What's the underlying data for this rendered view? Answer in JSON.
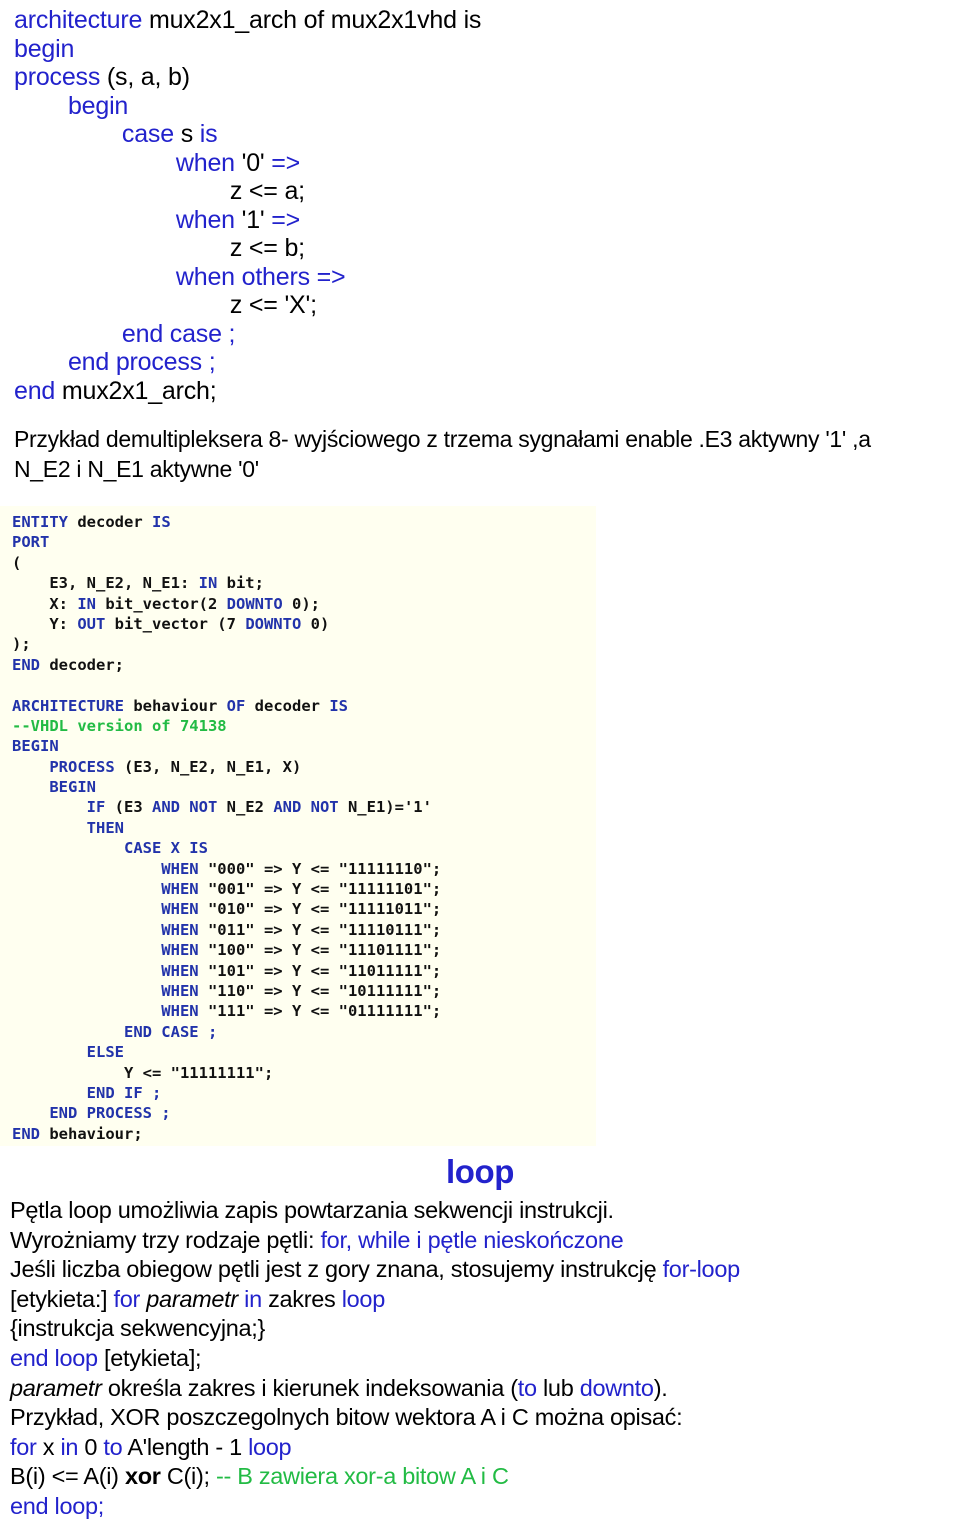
{
  "colors": {
    "keyword_blue": "#2222cc",
    "code_keyword_blue": "#2233aa",
    "comment_green": "#22bb44",
    "text_black": "#000000",
    "code_background": "#fffff0",
    "page_background": "#ffffff"
  },
  "vhdl_mux_listing": {
    "lines": [
      [
        {
          "t": "architecture ",
          "c": "kw"
        },
        {
          "t": "mux2x1_arch of mux2x1vhd is",
          "c": "id"
        }
      ],
      [
        {
          "t": "begin",
          "c": "kw"
        }
      ],
      [
        {
          "t": "process ",
          "c": "kw"
        },
        {
          "t": "(s, a, b)",
          "c": "id"
        }
      ],
      [
        {
          "t": "        begin",
          "c": "kw"
        }
      ],
      [
        {
          "t": "                case ",
          "c": "kw"
        },
        {
          "t": "s ",
          "c": "id"
        },
        {
          "t": "is",
          "c": "kw"
        }
      ],
      [
        {
          "t": "                        when ",
          "c": "kw"
        },
        {
          "t": "'0' ",
          "c": "id"
        },
        {
          "t": "=>",
          "c": "kw"
        }
      ],
      [
        {
          "t": "                                z <= a;",
          "c": "id"
        }
      ],
      [
        {
          "t": "                        when ",
          "c": "kw"
        },
        {
          "t": "'1' ",
          "c": "id"
        },
        {
          "t": "=>",
          "c": "kw"
        }
      ],
      [
        {
          "t": "                                z <= b;",
          "c": "id"
        }
      ],
      [
        {
          "t": "                        when others =>",
          "c": "kw"
        }
      ],
      [
        {
          "t": "                                z <= 'X';",
          "c": "id"
        }
      ],
      [
        {
          "t": "                end case ;",
          "c": "kw"
        }
      ],
      [
        {
          "t": "        end process ;",
          "c": "kw"
        }
      ],
      [
        {
          "t": "end ",
          "c": "kw"
        },
        {
          "t": "mux2x1_arch;",
          "c": "id"
        }
      ]
    ]
  },
  "demux_paragraph": {
    "lines": [
      "Przykład demultipleksera 8- wyjściowego z trzema sygnałami enable .E3 aktywny '1' ,a",
      "N_E2 i N_E1 aktywne '0'"
    ]
  },
  "decoder_code": {
    "lines": [
      [
        {
          "t": "ENTITY ",
          "c": "kw"
        },
        {
          "t": "decoder ",
          "c": "id"
        },
        {
          "t": "IS",
          "c": "kw"
        }
      ],
      [
        {
          "t": "PORT",
          "c": "kw"
        }
      ],
      [
        {
          "t": "(",
          "c": "id"
        }
      ],
      [
        {
          "t": "    E3, N_E2, N_E1: ",
          "c": "id"
        },
        {
          "t": "IN ",
          "c": "kw"
        },
        {
          "t": "bit;",
          "c": "id"
        }
      ],
      [
        {
          "t": "    X: ",
          "c": "id"
        },
        {
          "t": "IN ",
          "c": "kw"
        },
        {
          "t": "bit_vector(2 ",
          "c": "id"
        },
        {
          "t": "DOWNTO ",
          "c": "kw"
        },
        {
          "t": "0);",
          "c": "id"
        }
      ],
      [
        {
          "t": "    Y: ",
          "c": "id"
        },
        {
          "t": "OUT ",
          "c": "kw"
        },
        {
          "t": "bit_vector (7 ",
          "c": "id"
        },
        {
          "t": "DOWNTO ",
          "c": "kw"
        },
        {
          "t": "0)",
          "c": "id"
        }
      ],
      [
        {
          "t": ");",
          "c": "id"
        }
      ],
      [
        {
          "t": "END ",
          "c": "kw"
        },
        {
          "t": "decoder;",
          "c": "id"
        }
      ],
      [
        {
          "t": "",
          "c": "id"
        }
      ],
      [
        {
          "t": "ARCHITECTURE ",
          "c": "kw"
        },
        {
          "t": "behaviour ",
          "c": "id"
        },
        {
          "t": "OF ",
          "c": "kw"
        },
        {
          "t": "decoder ",
          "c": "id"
        },
        {
          "t": "IS",
          "c": "kw"
        }
      ],
      [
        {
          "t": "--VHDL version of 74138",
          "c": "cm"
        }
      ],
      [
        {
          "t": "BEGIN",
          "c": "kw"
        }
      ],
      [
        {
          "t": "    PROCESS ",
          "c": "kw"
        },
        {
          "t": "(E3, N_E2, N_E1, X)",
          "c": "id"
        }
      ],
      [
        {
          "t": "    BEGIN",
          "c": "kw"
        }
      ],
      [
        {
          "t": "        IF ",
          "c": "kw"
        },
        {
          "t": "(E3 ",
          "c": "id"
        },
        {
          "t": "AND NOT ",
          "c": "kw"
        },
        {
          "t": "N_E2 ",
          "c": "id"
        },
        {
          "t": "AND NOT ",
          "c": "kw"
        },
        {
          "t": "N_E1)='1'",
          "c": "id"
        }
      ],
      [
        {
          "t": "        THEN",
          "c": "kw"
        }
      ],
      [
        {
          "t": "            CASE X IS",
          "c": "kw"
        }
      ],
      [
        {
          "t": "                WHEN ",
          "c": "kw"
        },
        {
          "t": "\"000\" => Y <= \"11111110\";",
          "c": "id"
        }
      ],
      [
        {
          "t": "                WHEN ",
          "c": "kw"
        },
        {
          "t": "\"001\" => Y <= \"11111101\";",
          "c": "id"
        }
      ],
      [
        {
          "t": "                WHEN ",
          "c": "kw"
        },
        {
          "t": "\"010\" => Y <= \"11111011\";",
          "c": "id"
        }
      ],
      [
        {
          "t": "                WHEN ",
          "c": "kw"
        },
        {
          "t": "\"011\" => Y <= \"11110111\";",
          "c": "id"
        }
      ],
      [
        {
          "t": "                WHEN ",
          "c": "kw"
        },
        {
          "t": "\"100\" => Y <= \"11101111\";",
          "c": "id"
        }
      ],
      [
        {
          "t": "                WHEN ",
          "c": "kw"
        },
        {
          "t": "\"101\" => Y <= \"11011111\";",
          "c": "id"
        }
      ],
      [
        {
          "t": "                WHEN ",
          "c": "kw"
        },
        {
          "t": "\"110\" => Y <= \"10111111\";",
          "c": "id"
        }
      ],
      [
        {
          "t": "                WHEN ",
          "c": "kw"
        },
        {
          "t": "\"111\" => Y <= \"01111111\";",
          "c": "id"
        }
      ],
      [
        {
          "t": "            END CASE ;",
          "c": "kw"
        }
      ],
      [
        {
          "t": "        ELSE",
          "c": "kw"
        }
      ],
      [
        {
          "t": "            Y <= \"11111111\";",
          "c": "id"
        }
      ],
      [
        {
          "t": "        END IF ;",
          "c": "kw"
        }
      ],
      [
        {
          "t": "    END PROCESS ;",
          "c": "kw"
        }
      ],
      [
        {
          "t": "END ",
          "c": "kw"
        },
        {
          "t": "behaviour;",
          "c": "id"
        }
      ]
    ]
  },
  "loop_section": {
    "title": "loop",
    "lines": [
      [
        {
          "t": "Pętla loop umożliwia zapis powtarzania sekwencji instrukcji.",
          "c": "id"
        }
      ],
      [
        {
          "t": "Wyrożniamy trzy rodzaje pętli: ",
          "c": "id"
        },
        {
          "t": "for, while i pętle nieskończone",
          "c": "kw"
        }
      ],
      [
        {
          "t": "Jeśli liczba obiegow pętli jest z gory znana, stosujemy instrukcję ",
          "c": "id"
        },
        {
          "t": "for-loop",
          "c": "kw"
        }
      ],
      [
        {
          "t": "[etykieta:] ",
          "c": "id"
        },
        {
          "t": "for ",
          "c": "kw"
        },
        {
          "t": "parametr",
          "c": "id ital"
        },
        {
          "t": " ",
          "c": "id"
        },
        {
          "t": "in ",
          "c": "kw"
        },
        {
          "t": "zakres ",
          "c": "id"
        },
        {
          "t": "loop",
          "c": "kw"
        }
      ],
      [
        {
          "t": "{instrukcja sekwencyjna;}",
          "c": "id"
        }
      ],
      [
        {
          "t": "end loop ",
          "c": "kw"
        },
        {
          "t": "[etykieta];",
          "c": "id"
        }
      ],
      [
        {
          "t": "parametr",
          "c": "id ital"
        },
        {
          "t": " określa zakres i kierunek indeksowania (",
          "c": "id"
        },
        {
          "t": "to ",
          "c": "kw"
        },
        {
          "t": "lub ",
          "c": "id"
        },
        {
          "t": "downto",
          "c": "kw"
        },
        {
          "t": ").",
          "c": "id"
        }
      ],
      [
        {
          "t": "Przykład, XOR poszczegolnych bitow wektora A i C można opisać:",
          "c": "id"
        }
      ],
      [
        {
          "t": "for ",
          "c": "kw"
        },
        {
          "t": "x ",
          "c": "id"
        },
        {
          "t": "in ",
          "c": "kw"
        },
        {
          "t": "0 ",
          "c": "id"
        },
        {
          "t": "to ",
          "c": "kw"
        },
        {
          "t": "A'length - 1 ",
          "c": "id"
        },
        {
          "t": "loop",
          "c": "kw"
        }
      ],
      [
        {
          "t": "B(i) <= A(i) ",
          "c": "id"
        },
        {
          "t": "xor",
          "c": "id bold"
        },
        {
          "t": " C(i); ",
          "c": "id"
        },
        {
          "t": "-- B zawiera xor-a bitow A i C",
          "c": "cm"
        }
      ],
      [
        {
          "t": "end loop;",
          "c": "kw"
        }
      ]
    ]
  }
}
